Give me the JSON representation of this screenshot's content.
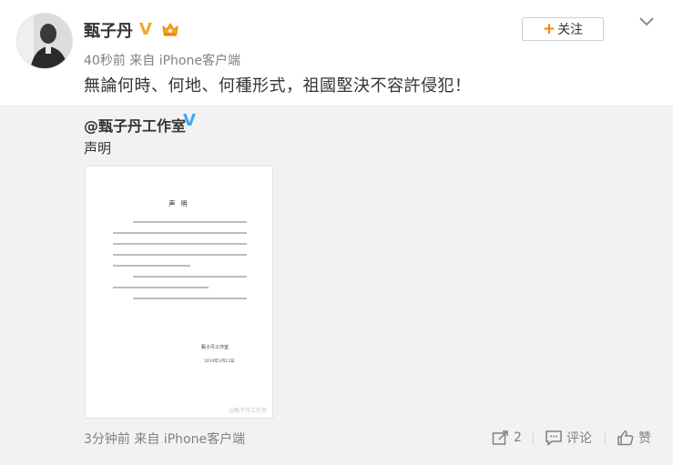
{
  "post": {
    "author": "甄子丹",
    "verified_mark": "V",
    "time": "40秒前 来自 iPhone客户端",
    "text": "無論何時、何地、何種形式，祖國堅決不容許侵犯！",
    "follow_label": "关注",
    "avatar_icon": "avatar-photo",
    "menu_icon": "chevron-down-icon"
  },
  "repost": {
    "author": "@甄子丹工作室",
    "verified_mark": "V",
    "text": "声明",
    "image": {
      "doc_title": "声 明",
      "signature": "甄子丹工作室",
      "date": "2019年1月12日",
      "watermark": "@甄子丹工作室"
    },
    "time": "3分钟前 来自 iPhone客户端",
    "forward_count": "2",
    "comment_label": "评论",
    "like_label": "赞"
  },
  "colors": {
    "accent_orange": "#ff8200",
    "verified_gold": "#f5a623",
    "verified_blue": "#3da8f5",
    "repost_bg": "#f2f2f5"
  }
}
